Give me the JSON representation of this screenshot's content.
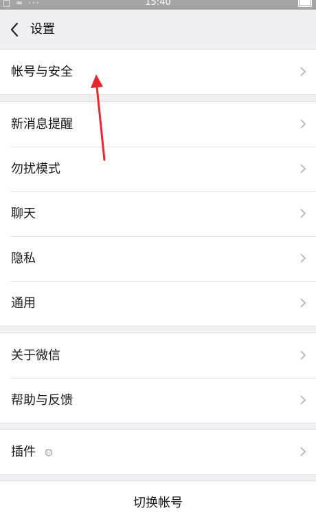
{
  "status_bar": {
    "time": "15:40",
    "left_icons": "□ ≈ ···"
  },
  "header": {
    "title": "设置"
  },
  "groups": {
    "account": {
      "items": [
        {
          "label": "帐号与安全"
        }
      ]
    },
    "general": {
      "items": [
        {
          "label": "新消息提醒"
        },
        {
          "label": "勿扰模式"
        },
        {
          "label": "聊天"
        },
        {
          "label": "隐私"
        },
        {
          "label": "通用"
        }
      ]
    },
    "about": {
      "items": [
        {
          "label": "关于微信"
        },
        {
          "label": "帮助与反馈"
        }
      ]
    },
    "plugins": {
      "items": [
        {
          "label": "插件"
        }
      ]
    }
  },
  "footer": {
    "switch_account_label": "切换帐号"
  },
  "colors": {
    "background": "#efeff4",
    "annotation_arrow": "#e8262b"
  }
}
